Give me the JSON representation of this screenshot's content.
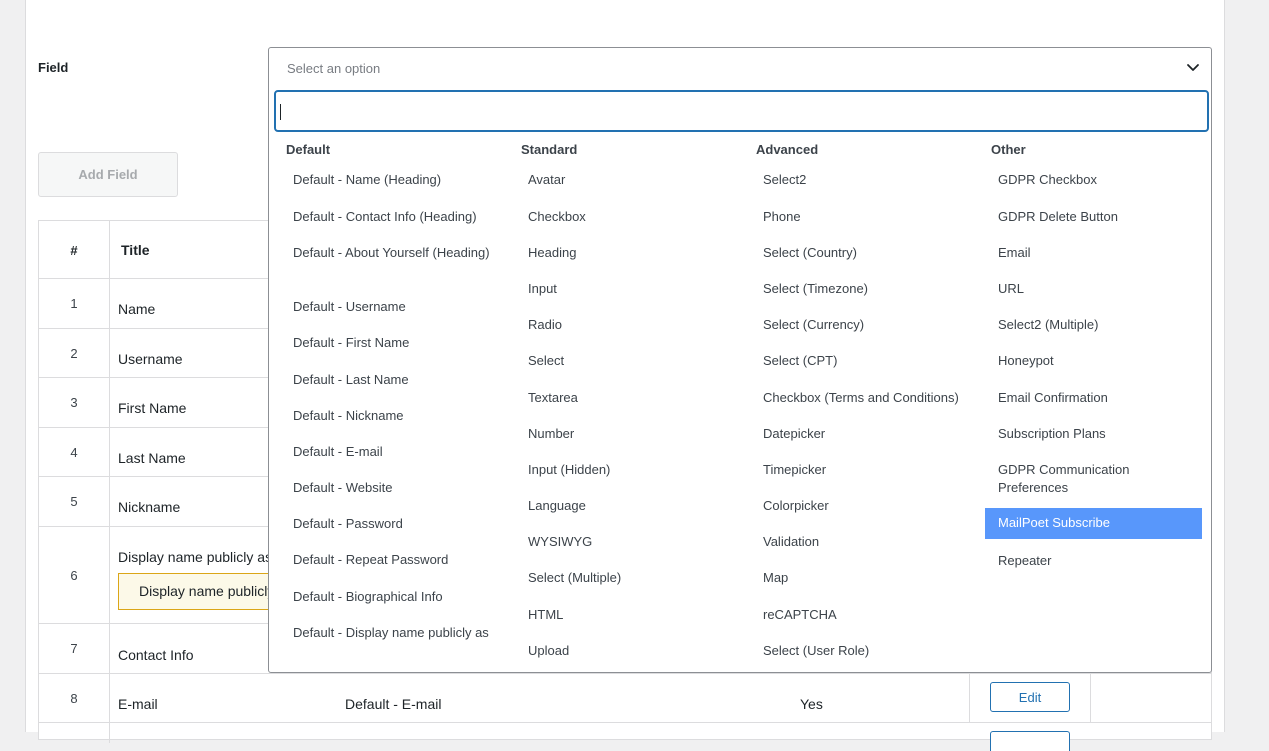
{
  "form": {
    "field_label": "Field",
    "add_field_label": "Add Field",
    "select_placeholder": "Select an option"
  },
  "table": {
    "headers": {
      "num": "#",
      "title": "Title"
    },
    "rows": [
      {
        "num": "1",
        "title": "Name"
      },
      {
        "num": "2",
        "title": "Username"
      },
      {
        "num": "3",
        "title": "First Name"
      },
      {
        "num": "4",
        "title": "Last Name"
      },
      {
        "num": "5",
        "title": "Nickname"
      },
      {
        "num": "6",
        "title": "Display name publicly as",
        "notice": "Display name publicly"
      },
      {
        "num": "7",
        "title": "Contact Info"
      },
      {
        "num": "8",
        "title": "E-mail",
        "type": "Default - E-mail",
        "required": "Yes",
        "edit": "Edit"
      }
    ]
  },
  "dropdown": {
    "columns": [
      {
        "heading": "Default",
        "options": [
          "Default - Name (Heading)",
          "Default - Contact Info (Heading)",
          "Default - About Yourself (Heading)",
          "Default - Username",
          "Default - First Name",
          "Default - Last Name",
          "Default - Nickname",
          "Default - E-mail",
          "Default - Website",
          "Default - Password",
          "Default - Repeat Password",
          "Default - Biographical Info",
          "Default - Display name publicly as"
        ]
      },
      {
        "heading": "Standard",
        "options": [
          "Avatar",
          "Checkbox",
          "Heading",
          "Input",
          "Radio",
          "Select",
          "Textarea",
          "Number",
          "Input (Hidden)",
          "Language",
          "WYSIWYG",
          "Select (Multiple)",
          "HTML",
          "Upload"
        ]
      },
      {
        "heading": "Advanced",
        "options": [
          "Select2",
          "Phone",
          "Select (Country)",
          "Select (Timezone)",
          "Select (Currency)",
          "Select (CPT)",
          "Checkbox (Terms and Conditions)",
          "Datepicker",
          "Timepicker",
          "Colorpicker",
          "Validation",
          "Map",
          "reCAPTCHA",
          "Select (User Role)"
        ]
      },
      {
        "heading": "Other",
        "options": [
          "GDPR Checkbox",
          "GDPR Delete Button",
          "Email",
          "URL",
          "Select2 (Multiple)",
          "Honeypot",
          "Email Confirmation",
          "Subscription Plans",
          "GDPR Communication Preferences",
          "MailPoet Subscribe",
          "Repeater"
        ],
        "highlighted": "MailPoet Subscribe"
      }
    ]
  },
  "colors": {
    "accent": "#2271b1",
    "highlight": "#5897fb",
    "notice_border": "#dba617"
  },
  "icons": {
    "select_toggle": "chevron-down-icon"
  }
}
